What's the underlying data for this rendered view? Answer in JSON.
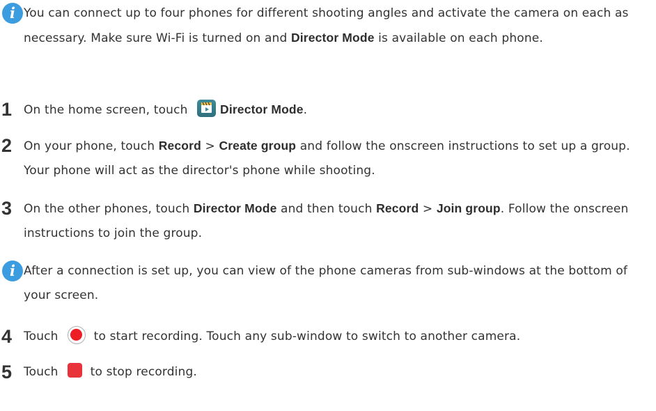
{
  "note1": {
    "text_a": "You can connect up to four phones for different shooting angles and activate the camera on each as necessary. Make sure Wi-Fi is turned on and ",
    "bold_a": "Director Mode",
    "text_b": " is available on each phone."
  },
  "step1": {
    "num": "1",
    "text_a": "On the home screen, touch ",
    "bold_a": "Director Mode",
    "text_b": "."
  },
  "step2": {
    "num": "2",
    "text_a": "On your phone, touch ",
    "bold_a": "Record",
    "sep": " > ",
    "bold_b": "Create group",
    "text_b": " and follow the onscreen instructions to set up a group. Your phone will act as the director's phone while shooting."
  },
  "step3": {
    "num": "3",
    "text_a": "On the other phones, touch ",
    "bold_a": "Director Mode",
    "text_b": " and then touch ",
    "bold_b": "Record",
    "sep": " > ",
    "bold_c": "Join group",
    "text_c": ". Follow the onscreen instructions to join the group."
  },
  "note2": {
    "text": "After a connection is set up, you can view of the phone cameras from sub-windows at the bottom of your screen."
  },
  "step4": {
    "num": "4",
    "text_a": "Touch ",
    "text_b": " to start recording. Touch any sub-window to switch to another camera."
  },
  "step5": {
    "num": "5",
    "text_a": "Touch ",
    "text_b": " to stop recording."
  },
  "icons": {
    "info": "info-icon",
    "app": "director-mode-app-icon",
    "record": "record-button-icon",
    "stop": "stop-button-icon"
  },
  "colors": {
    "info_blue": "#3b9de0",
    "record_red": "#ee1c25",
    "stop_red": "#e8333b",
    "app_teal": "#3d8b9a"
  }
}
